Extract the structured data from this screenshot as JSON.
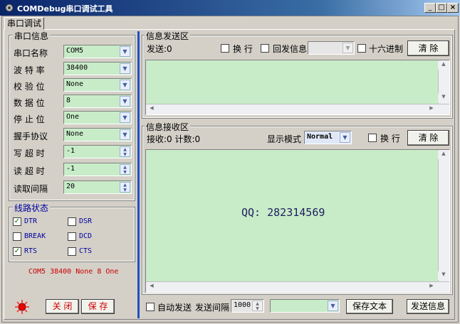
{
  "window": {
    "title": "COMDebug串口调试工具",
    "min": "_",
    "max": "□",
    "close": "×"
  },
  "tab": {
    "label": "串口调试"
  },
  "serial": {
    "title": "串口信息",
    "rows": [
      {
        "label": "串口名称",
        "value": "COM5"
      },
      {
        "label": "波 特 率",
        "value": "38400"
      },
      {
        "label": "校 验 位",
        "value": "None"
      },
      {
        "label": "数 据 位",
        "value": "8"
      },
      {
        "label": "停 止 位",
        "value": "One"
      },
      {
        "label": "握手协议",
        "value": "None"
      },
      {
        "label": "写 超 时",
        "value": "-1"
      },
      {
        "label": "读 超 时",
        "value": "-1"
      },
      {
        "label": "读取间隔",
        "value": "20"
      }
    ]
  },
  "line": {
    "title": "线路状态",
    "items": [
      {
        "label": "DTR",
        "checked": true
      },
      {
        "label": "DSR",
        "checked": false
      },
      {
        "label": "BREAK",
        "checked": false
      },
      {
        "label": "DCD",
        "checked": false
      },
      {
        "label": "RTS",
        "checked": true
      },
      {
        "label": "CTS",
        "checked": false
      }
    ]
  },
  "status": {
    "summary": "COM5 38400 None 8 One"
  },
  "buttons": {
    "close": "关 闭",
    "save": "保 存"
  },
  "send": {
    "title": "信息发送区",
    "count": "发送:0",
    "wrap": "换 行",
    "echo": "回发信息",
    "hex": "十六进制",
    "clear": "清 除"
  },
  "recv": {
    "title": "信息接收区",
    "count": "接收:0 计数:0",
    "mode_label": "显示模式",
    "mode": "Normal",
    "wrap": "换 行",
    "clear": "清 除",
    "content": "QQ: 282314569"
  },
  "bottom": {
    "auto_send": "自动发送",
    "interval_label": "发送间隔",
    "interval": "1000",
    "save_text": "保存文本",
    "send_info": "发送信息"
  },
  "colors": {
    "field": "#c8ecc8",
    "title_bar": "#0a246a",
    "accent_blue": "#0000a0",
    "status_red": "#cc0000"
  }
}
